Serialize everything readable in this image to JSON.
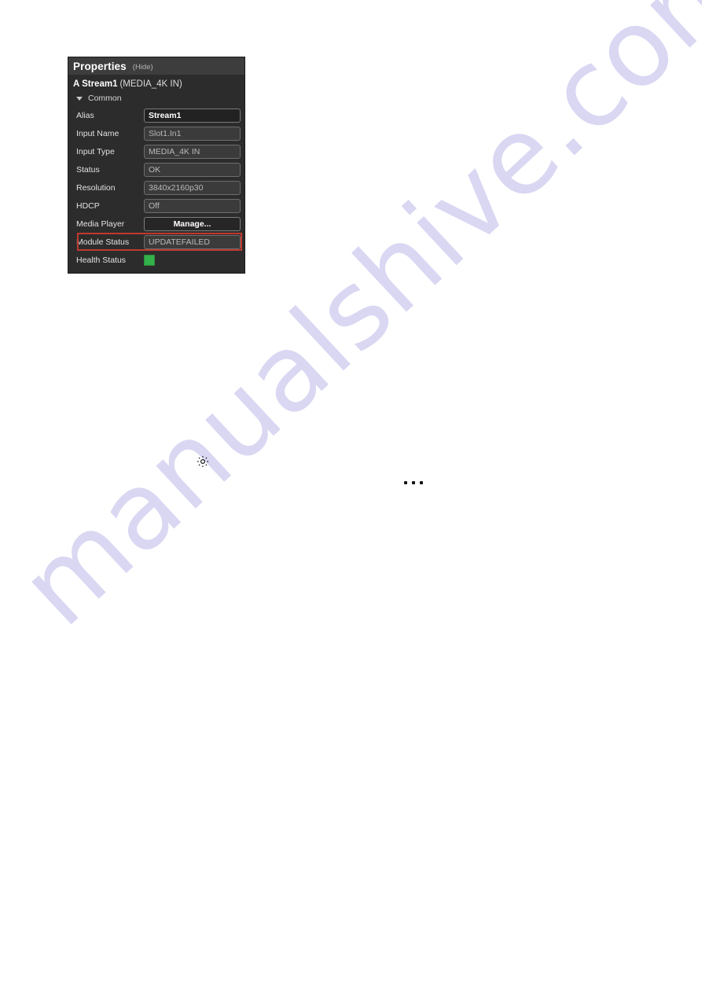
{
  "page": {
    "watermark": "manualshive.com",
    "watermark_color": "#d7d5f2",
    "icons": {
      "gear": "gear-icon",
      "ellipsis": "ellipsis-icon"
    }
  },
  "panel": {
    "header": {
      "title": "Properties",
      "hide_label": "(Hide)"
    },
    "subtitle": {
      "name": "A Stream1",
      "type": "(MEDIA_4K IN)"
    },
    "group": {
      "label": "Common",
      "expanded": true,
      "caret_icon": "chevron-down-icon"
    },
    "highlight_color": "#c0392f",
    "health_color": "#33b14a",
    "rows": [
      {
        "label": "Alias",
        "value": "Stream1",
        "style": "editable"
      },
      {
        "label": "Input Name",
        "value": "Slot1.In1",
        "style": "readonly"
      },
      {
        "label": "Input Type",
        "value": "MEDIA_4K IN",
        "style": "readonly"
      },
      {
        "label": "Status",
        "value": "OK",
        "style": "readonly"
      },
      {
        "label": "Resolution",
        "value": "3840x2160p30",
        "style": "readonly"
      },
      {
        "label": "HDCP",
        "value": "Off",
        "style": "readonly"
      },
      {
        "label": "Media Player",
        "value": "Manage...",
        "style": "button"
      },
      {
        "label": "Module Status",
        "value": "UPDATEFAILED",
        "style": "readonly",
        "highlighted": true
      },
      {
        "label": "Health Status",
        "value": "",
        "style": "swatch"
      }
    ]
  }
}
